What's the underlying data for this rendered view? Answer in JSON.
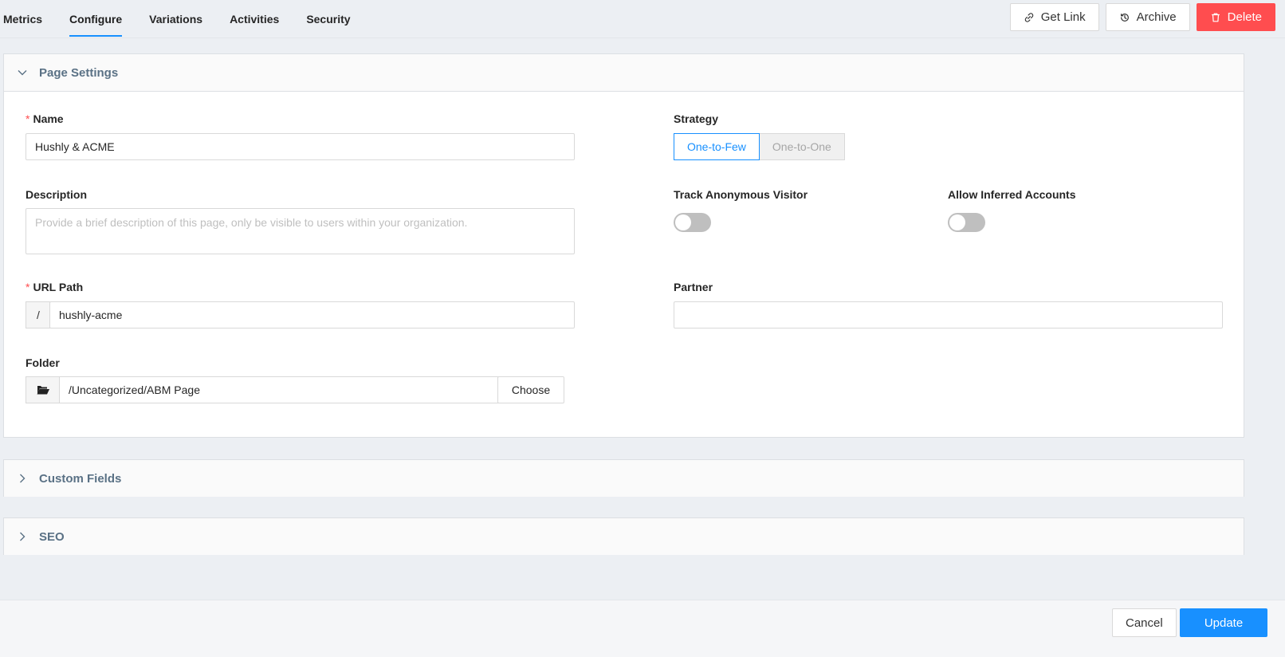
{
  "tabs": [
    {
      "label": "Metrics"
    },
    {
      "label": "Configure",
      "active": true
    },
    {
      "label": "Variations"
    },
    {
      "label": "Activities"
    },
    {
      "label": "Security"
    }
  ],
  "actions": {
    "get_link": "Get Link",
    "archive": "Archive",
    "delete": "Delete"
  },
  "page_settings": {
    "title": "Page Settings",
    "name": {
      "label": "Name",
      "value": "Hushly &  ACME"
    },
    "description": {
      "label": "Description",
      "placeholder": "Provide a brief description of this page, only be visible to users within your organization."
    },
    "url_path": {
      "label": "URL Path",
      "prefix": "/",
      "value": "hushly-acme"
    },
    "folder": {
      "label": "Folder",
      "value": "/Uncategorized/ABM Page",
      "choose": "Choose"
    },
    "strategy": {
      "label": "Strategy",
      "options": [
        "One-to-Few",
        "One-to-One"
      ],
      "selected": "One-to-Few"
    },
    "track_anonymous": {
      "label": "Track Anonymous Visitor",
      "on": false
    },
    "allow_inferred": {
      "label": "Allow Inferred Accounts",
      "on": false
    },
    "partner": {
      "label": "Partner",
      "value": ""
    }
  },
  "custom_fields": {
    "title": "Custom Fields"
  },
  "seo": {
    "title": "SEO"
  },
  "footer": {
    "cancel": "Cancel",
    "update": "Update"
  },
  "colors": {
    "primary": "#1890ff",
    "danger": "#ff4d4f",
    "required": "#ff4d4f"
  }
}
